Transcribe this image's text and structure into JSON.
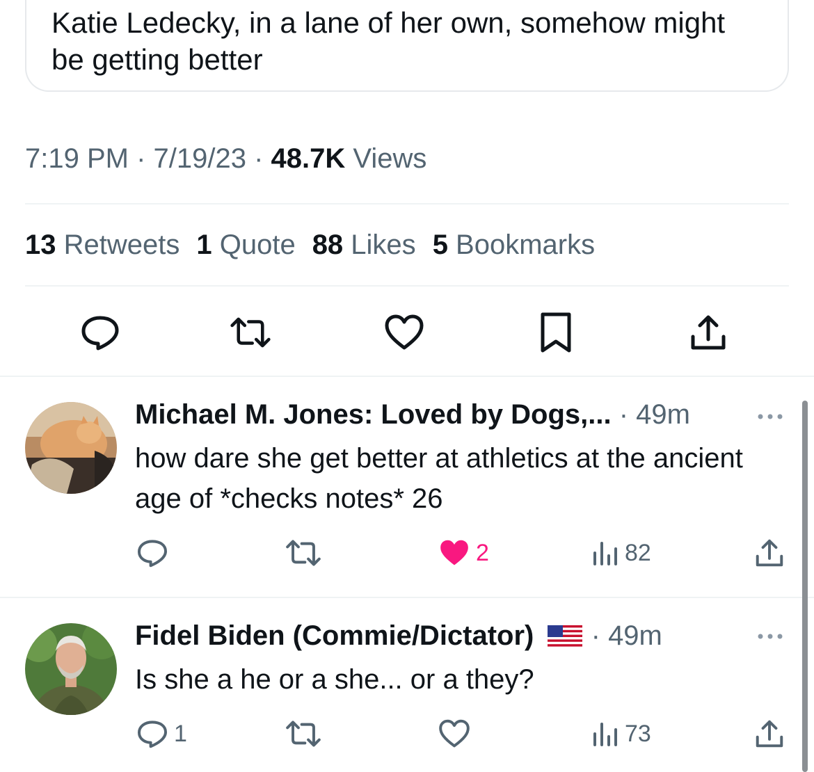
{
  "card": {
    "title": "Katie Ledecky, in a lane of her own, somehow might be getting better"
  },
  "meta": {
    "time": "7:19 PM",
    "sep1": " · ",
    "date": "7/19/23",
    "sep2": " · ",
    "views_count": "48.7K",
    "views_label": " Views"
  },
  "stats": [
    {
      "count": "13",
      "label": " Retweets"
    },
    {
      "count": "1",
      "label": " Quote"
    },
    {
      "count": "88",
      "label": " Likes"
    },
    {
      "count": "5",
      "label": " Bookmarks"
    }
  ],
  "actions": [
    "reply-icon",
    "retweet-icon",
    "like-icon",
    "bookmark-icon",
    "share-icon"
  ],
  "replies": [
    {
      "name": "Michael M. Jones: Loved by Dogs,...",
      "time": " · 49m",
      "text": "how dare she get better at athletics at the ancient age of *checks notes* 26",
      "reply_count": "",
      "like_count": "2",
      "views_count": "82",
      "liked": true
    },
    {
      "name": "Fidel Biden (Commie/Dictator)",
      "flag": "us-flag-icon",
      "time": " · 49m",
      "text": "Is she a he or a she... or a they?",
      "reply_count": "1",
      "like_count": "",
      "views_count": "73",
      "liked": false
    }
  ],
  "colors": {
    "text": "#0f1419",
    "secondary": "#536471",
    "like": "#f91880",
    "divider": "#eff3f4"
  }
}
